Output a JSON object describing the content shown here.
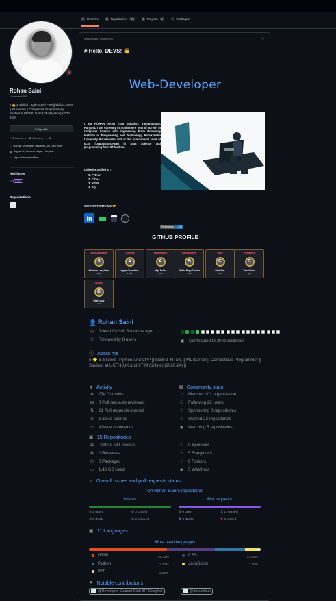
{
  "tabs": [
    {
      "label": "Overview",
      "count": ""
    },
    {
      "label": "Repositories",
      "count": "15"
    },
    {
      "label": "Projects",
      "count": "1"
    },
    {
      "label": "Packages",
      "count": ""
    }
  ],
  "sidebar": {
    "name": "Rohan Saini",
    "login": "rohansaini888",
    "bio": "5 ⭐ & Skilled - Python And CPP || Skilled- HTML || ML learner || Competitive Programmer || Student at UIET-KUK and IIT-M (online) (2020-24) ||",
    "edit_label": "Edit profile",
    "followers": "8",
    "followers_label": "followers",
    "following": "22",
    "following_label": "following",
    "stars": "20",
    "org_meta": "Google Developer Student Club UIET KUK",
    "location": "Jagadhri, Yamuna Nagar, Haryana",
    "website": "https://rohansaini.live",
    "highlights_title": "Highlights",
    "pro_label": "PRO",
    "orgs_title": "Organizations",
    "org_logo_text": "<>"
  },
  "readme": {
    "path": "rohansaini888 / README.md",
    "hello": "# Hello, DEVS! 👋",
    "banner": "Web-Developer",
    "about": "I am ROHAN SAINI from Jagadhri, Yamunanagar, Haryana. I am currently in Sophomore year of B.Tech in Computer Science and Engineering From University Institute of Eniigneering and Technology, Kurukshetra University Kurukshetra and at the foundational level of B.Sc (ONLINEDEGREE) in Data Science and programming from IIT Madras.",
    "skills_heading": "LinkedIn Skilled at :-",
    "skills": [
      "1. Python",
      "2. C\\C++",
      "3. HTML",
      "4. SQL"
    ],
    "connect": "CONNECT WITH ME 🤝",
    "social_icons": [
      "linkedin-icon",
      "hackerrank-icon",
      "hackerearth-icon",
      "github-icon"
    ],
    "views_label": "Profile views",
    "views_value": "1,019",
    "github_profile": "GITHUB PROFILE"
  },
  "trophies": [
    {
      "title": "MultiLanguage",
      "rank": "S",
      "name": "Rainbow Lang User",
      "score": "10pt"
    },
    {
      "title": "Commits",
      "rank": "A",
      "name": "Hyper Committer",
      "score": "274pt"
    },
    {
      "title": "PullRequest",
      "rank": "A",
      "name": "High Puller",
      "score": "20pt"
    },
    {
      "title": "Repositories",
      "rank": "B",
      "name": "Middle Repo Creator",
      "score": "14pt"
    },
    {
      "title": "Stars",
      "rank": "C",
      "name": "First Star",
      "score": "6pt"
    },
    {
      "title": "Followers",
      "rank": "C",
      "name": "First Friend",
      "score": "8pt"
    },
    {
      "title": "Issues",
      "rank": "C",
      "name": "First Issue",
      "score": "1pt"
    }
  ],
  "metrics": {
    "name": "Rohan Saini",
    "joined": "Joined GitHub 6 months ago",
    "followed": "Followed by 8 users",
    "contributed": "Contributed to 20 repositories",
    "about_title": "About me",
    "about": "5 ⭐ & Skilled - Python And CPP || Skilled- HTML || ML learner || Competitive Programmer || Student at UIET-KUK and IIT-M (online) (2020-24) ||",
    "activity_title": "Activity",
    "activity": [
      "274 Commits",
      "0 Pull requests reviewed",
      "21 Pull requests opened",
      "1 Issue opened",
      "4 issue comments"
    ],
    "community_title": "Community stats",
    "community": [
      "Member of 1 organization",
      "Following 22 users",
      "Sponsoring 0 repositories",
      "Starred 22 repositories",
      "Watching 5 repositories"
    ],
    "repos_title": "15 Repositories",
    "repos_left": [
      "Prefers MIT license",
      "0 Releases",
      "0 Packages",
      "1.42 GB used"
    ],
    "repos_right": [
      "0 Sponsors",
      "5 Stargazers",
      "0 Forkers",
      "5 Watchers"
    ],
    "overall_title": "Overall issues and pull requests status",
    "on_label": "On Rohan Saini's repositories",
    "issues_label": "Issues",
    "prs_label": "Pull requests",
    "issues": [
      "1 open",
      "0 drafts",
      "0 closed",
      "0 skipped"
    ],
    "prs": [
      "0 open",
      "0 drafts",
      "1 merged",
      "0 closed"
    ],
    "langs_title": "11 Languages",
    "most_used": "Most used languages",
    "languages": [
      {
        "name": "HTML",
        "pct": "45.31%",
        "color": "#e34c26"
      },
      {
        "name": "CSS",
        "pct": "27.83%",
        "color": "#563d7c"
      },
      {
        "name": "Python",
        "pct": "17.57%",
        "color": "#3572a5"
      },
      {
        "name": "JavaScript",
        "pct": "7.07%",
        "color": "#f1e05a"
      },
      {
        "name": "Roff",
        "pct": "2.22%",
        "color": "#ecdebe"
      }
    ],
    "notable_title": "Notable contributions",
    "notable": [
      "@Developer Student Club BIT Deoghar",
      "@dscuietkuk"
    ]
  },
  "colors": {
    "accent": "#58a6ff",
    "bg": "#0d1117",
    "border": "#30363d",
    "issues_green": "#238636",
    "prs_purple": "#8957e5"
  }
}
